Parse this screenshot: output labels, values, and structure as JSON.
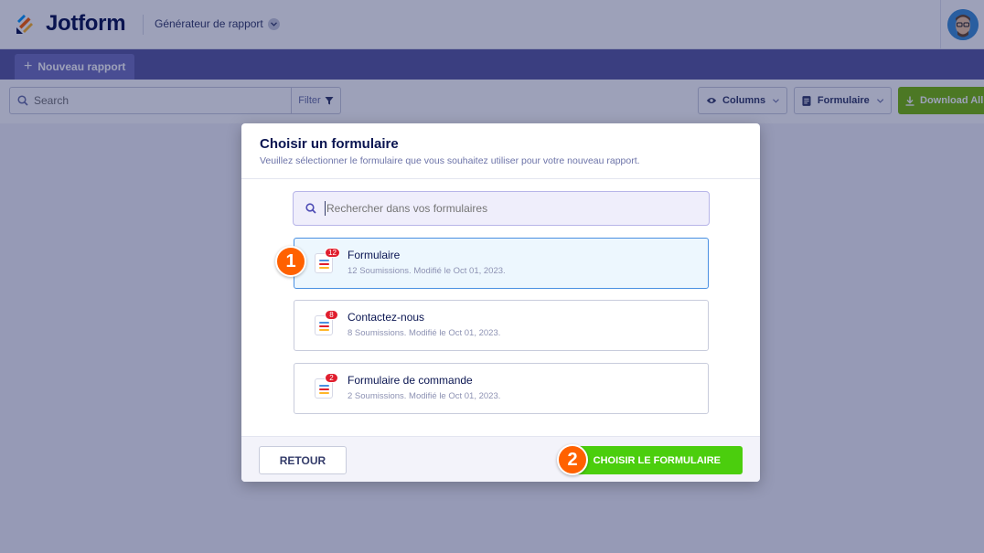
{
  "header": {
    "logo_text": "Jotform",
    "app_switch_label": "Générateur de rapport"
  },
  "toolbar": {
    "new_report_label": "Nouveau rapport"
  },
  "filterbar": {
    "search_placeholder": "Search",
    "filter_label": "Filter",
    "columns_label": "Columns",
    "form_label": "Formulaire",
    "download_label": "Download All"
  },
  "modal": {
    "title": "Choisir un formulaire",
    "subtitle": "Veuillez sélectionner le formulaire que vous souhaitez utiliser pour votre nouveau rapport.",
    "search_placeholder": "Rechercher dans vos formulaires",
    "forms": [
      {
        "name": "Formulaire",
        "meta": "12 Soumissions. Modifié le Oct 01, 2023.",
        "badge": "12",
        "selected": true
      },
      {
        "name": "Contactez-nous",
        "meta": "8 Soumissions. Modifié le Oct 01, 2023.",
        "badge": "8",
        "selected": false
      },
      {
        "name": "Formulaire de commande",
        "meta": "2 Soumissions. Modifié le Oct 01, 2023.",
        "badge": "2",
        "selected": false
      }
    ],
    "back_label": "RETOUR",
    "choose_label": "CHOISIR LE FORMULAIRE"
  },
  "steps": [
    "1",
    "2"
  ],
  "colors": {
    "accent_purple": "#5b5aa0",
    "green": "#4bce0d",
    "step_orange": "#ff6100",
    "badge_red": "#e01e2e"
  }
}
